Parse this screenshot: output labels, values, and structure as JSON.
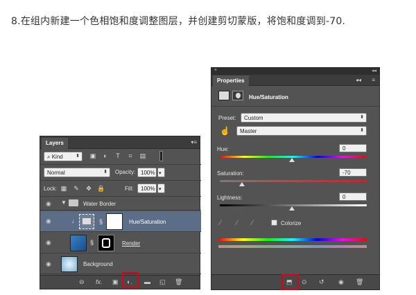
{
  "caption": "8.在组内新建一个色相饱和度调整图层，并创建剪切蒙版，将饱和度调到-70.",
  "layers_panel": {
    "title": "Layers",
    "filter_kind": "Kind",
    "blend_mode": "Normal",
    "opacity_label": "Opacity:",
    "opacity_value": "100%",
    "lock_label": "Lock:",
    "fill_label": "Fill:",
    "fill_value": "100%",
    "layers": [
      {
        "name": "Water Border",
        "type": "group"
      },
      {
        "name": "Hue/Saturation",
        "type": "adjustment",
        "selected": true
      },
      {
        "name": "Render",
        "type": "image"
      },
      {
        "name": "Background",
        "type": "image"
      }
    ]
  },
  "properties_panel": {
    "title": "Properties",
    "adjustment_name": "Hue/Saturation",
    "preset_label": "Preset:",
    "preset_value": "Custom",
    "channel_value": "Master",
    "hue_label": "Hue:",
    "hue_value": "0",
    "saturation_label": "Saturation:",
    "saturation_value": "-70",
    "lightness_label": "Lightness:",
    "lightness_value": "0",
    "colorize_label": "Colorize"
  },
  "colors": {
    "panel_bg": "#535353",
    "selected_row": "#5b6d87",
    "highlight_red": "#e0001a"
  }
}
